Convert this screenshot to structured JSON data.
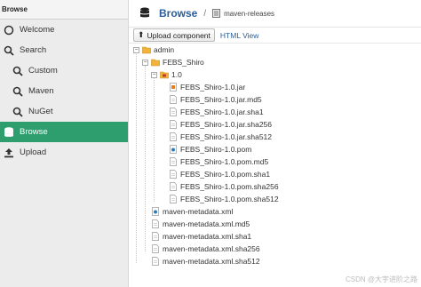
{
  "sidebar": {
    "header": "Browse",
    "items": [
      {
        "label": "Welcome",
        "icon": "circle-icon",
        "level": 0,
        "active": false
      },
      {
        "label": "Search",
        "icon": "search-icon",
        "level": 0,
        "active": false
      },
      {
        "label": "Custom",
        "icon": "search-icon",
        "level": 1,
        "active": false
      },
      {
        "label": "Maven",
        "icon": "search-icon",
        "level": 1,
        "active": false
      },
      {
        "label": "NuGet",
        "icon": "search-icon",
        "level": 1,
        "active": false
      },
      {
        "label": "Browse",
        "icon": "database-icon",
        "level": 0,
        "active": true
      },
      {
        "label": "Upload",
        "icon": "upload-icon",
        "level": 0,
        "active": false
      }
    ]
  },
  "header": {
    "title": "Browse",
    "separator": "/",
    "repo": "maven-releases"
  },
  "toolbar": {
    "upload_label": "Upload component",
    "html_view_label": "HTML View"
  },
  "tree": [
    {
      "label": "admin",
      "type": "folder",
      "depth": 0,
      "toggle": "−"
    },
    {
      "label": "FEBS_Shiro",
      "type": "folder",
      "depth": 1,
      "toggle": "−"
    },
    {
      "label": "1.0",
      "type": "folder-component",
      "depth": 2,
      "toggle": "−"
    },
    {
      "label": "FEBS_Shiro-1.0.jar",
      "type": "jar",
      "depth": 3
    },
    {
      "label": "FEBS_Shiro-1.0.jar.md5",
      "type": "file",
      "depth": 3
    },
    {
      "label": "FEBS_Shiro-1.0.jar.sha1",
      "type": "file",
      "depth": 3
    },
    {
      "label": "FEBS_Shiro-1.0.jar.sha256",
      "type": "file",
      "depth": 3
    },
    {
      "label": "FEBS_Shiro-1.0.jar.sha512",
      "type": "file",
      "depth": 3
    },
    {
      "label": "FEBS_Shiro-1.0.pom",
      "type": "pom",
      "depth": 3
    },
    {
      "label": "FEBS_Shiro-1.0.pom.md5",
      "type": "file",
      "depth": 3
    },
    {
      "label": "FEBS_Shiro-1.0.pom.sha1",
      "type": "file",
      "depth": 3
    },
    {
      "label": "FEBS_Shiro-1.0.pom.sha256",
      "type": "file",
      "depth": 3
    },
    {
      "label": "FEBS_Shiro-1.0.pom.sha512",
      "type": "file",
      "depth": 3
    },
    {
      "label": "maven-metadata.xml",
      "type": "xml",
      "depth": 1
    },
    {
      "label": "maven-metadata.xml.md5",
      "type": "file",
      "depth": 1
    },
    {
      "label": "maven-metadata.xml.sha1",
      "type": "file",
      "depth": 1
    },
    {
      "label": "maven-metadata.xml.sha256",
      "type": "file",
      "depth": 1
    },
    {
      "label": "maven-metadata.xml.sha512",
      "type": "file",
      "depth": 1
    }
  ],
  "watermark": "CSDN @大宇进阶之路",
  "colors": {
    "accent": "#2e9e6e",
    "title": "#2a5d99",
    "folder": "#f0b43c"
  }
}
